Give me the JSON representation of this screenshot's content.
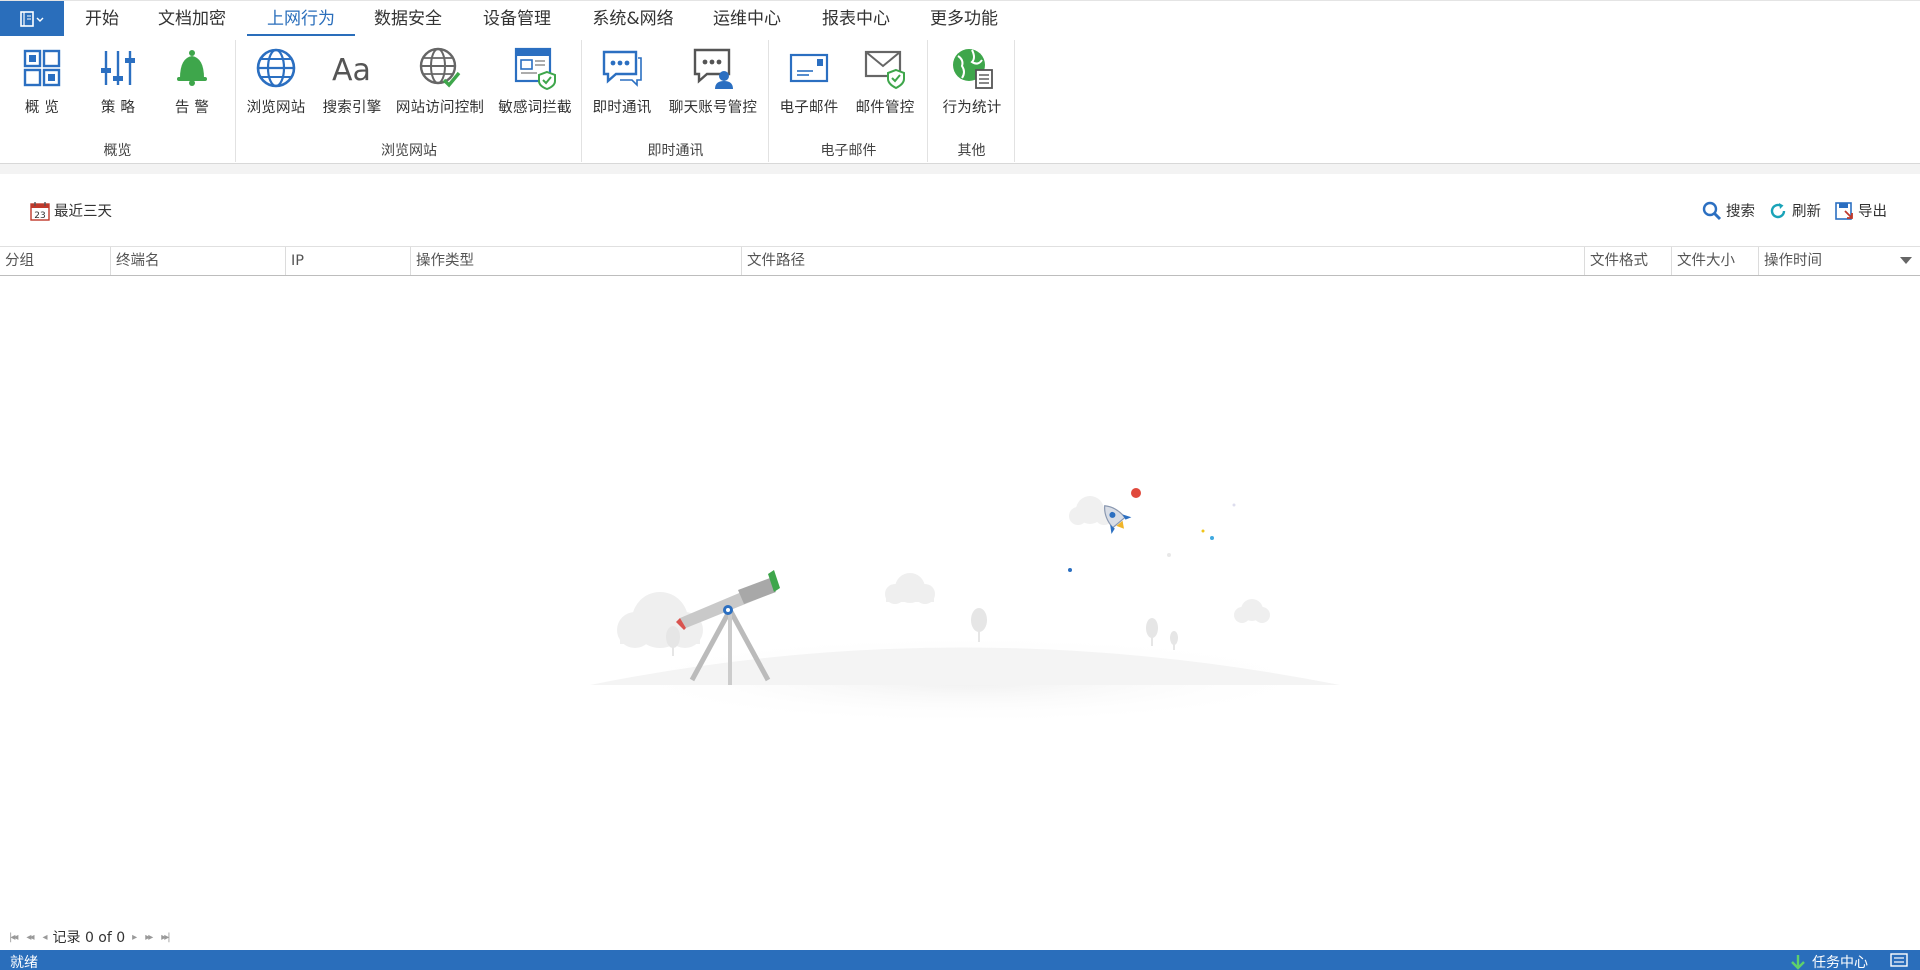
{
  "menu_tabs": [
    {
      "label": "开始"
    },
    {
      "label": "文档加密"
    },
    {
      "label": "上网行为",
      "active": true
    },
    {
      "label": "数据安全"
    },
    {
      "label": "设备管理"
    },
    {
      "label": "系统&网络"
    },
    {
      "label": "运维中心"
    },
    {
      "label": "报表中心"
    },
    {
      "label": "更多功能"
    }
  ],
  "ribbon": {
    "groups": [
      {
        "label": "概览",
        "items": [
          {
            "label": "概 览",
            "icon": "overview-grid-icon"
          },
          {
            "label": "策 略",
            "icon": "policy-sliders-icon"
          },
          {
            "label": "告 警",
            "icon": "alarm-bell-icon"
          }
        ]
      },
      {
        "label": "浏览网站",
        "items": [
          {
            "label": "浏览网站",
            "icon": "globe-icon"
          },
          {
            "label": "搜索引擎",
            "icon": "search-engine-aa-icon"
          },
          {
            "label": "网站访问控制",
            "icon": "globe-check-icon"
          },
          {
            "label": "敏感词拦截",
            "icon": "web-shield-icon"
          }
        ]
      },
      {
        "label": "即时通讯",
        "items": [
          {
            "label": "即时通讯",
            "icon": "chat-bubble-icon"
          },
          {
            "label": "聊天账号管控",
            "icon": "chat-user-icon"
          }
        ]
      },
      {
        "label": "电子邮件",
        "items": [
          {
            "label": "电子邮件",
            "icon": "envelope-icon"
          },
          {
            "label": "邮件管控",
            "icon": "envelope-check-icon"
          }
        ]
      },
      {
        "label": "其他",
        "items": [
          {
            "label": "行为统计",
            "icon": "stats-globe-icon"
          }
        ]
      }
    ]
  },
  "toolbar": {
    "date_filter": "最近三天",
    "calendar_day": "23",
    "search": "搜索",
    "refresh": "刷新",
    "export": "导出"
  },
  "grid": {
    "columns": [
      "分组",
      "终端名",
      "IP",
      "操作类型",
      "文件路径",
      "文件格式",
      "文件大小",
      "操作时间"
    ],
    "rows": []
  },
  "pager": {
    "label": "记录 0 of 0"
  },
  "status": {
    "text": "就绪",
    "task_center": "任务中心"
  },
  "colors": {
    "accent": "#2a6ebb",
    "icon_blue": "#2b6fc1",
    "icon_green": "#3ea64b"
  }
}
